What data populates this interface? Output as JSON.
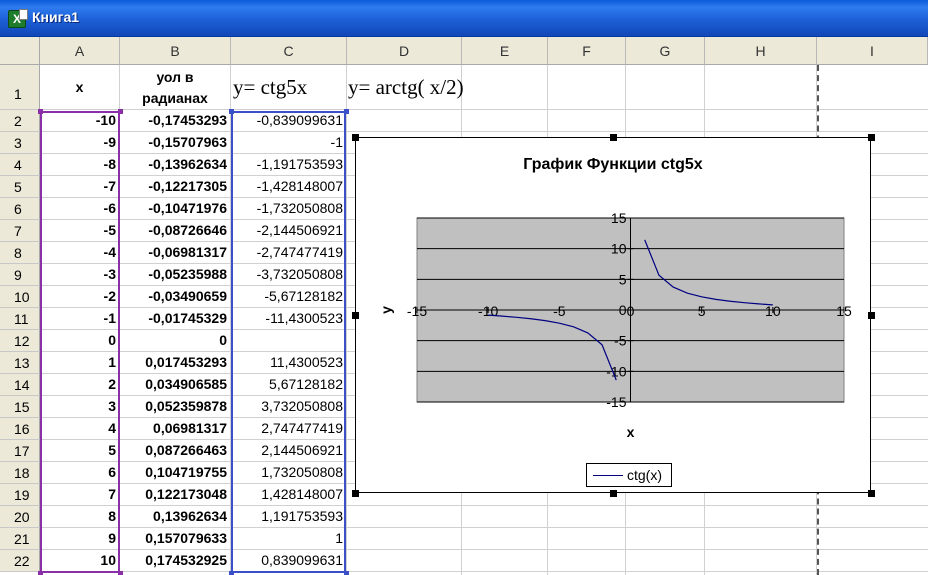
{
  "window": {
    "title": "Книга1"
  },
  "columns": [
    "A",
    "B",
    "C",
    "D",
    "E",
    "F",
    "G",
    "H",
    "I"
  ],
  "rows": [
    "1",
    "2",
    "3",
    "4",
    "5",
    "6",
    "7",
    "8",
    "9",
    "10",
    "11",
    "12",
    "13",
    "14",
    "15",
    "16",
    "17",
    "18",
    "19",
    "20",
    "21",
    "22"
  ],
  "header_row": {
    "a": "x",
    "b_line1": "уол в",
    "b_line2": "радианах",
    "c": "y= ctg5x",
    "d": "y= arctg( x/2)"
  },
  "table": [
    {
      "x": "-10",
      "rad": "-0,17453293",
      "ctg": "-0,839099631"
    },
    {
      "x": "-9",
      "rad": "-0,15707963",
      "ctg": "-1"
    },
    {
      "x": "-8",
      "rad": "-0,13962634",
      "ctg": "-1,191753593"
    },
    {
      "x": "-7",
      "rad": "-0,12217305",
      "ctg": "-1,428148007"
    },
    {
      "x": "-6",
      "rad": "-0,10471976",
      "ctg": "-1,732050808"
    },
    {
      "x": "-5",
      "rad": "-0,08726646",
      "ctg": "-2,144506921"
    },
    {
      "x": "-4",
      "rad": "-0,06981317",
      "ctg": "-2,747477419"
    },
    {
      "x": "-3",
      "rad": "-0,05235988",
      "ctg": "-3,732050808"
    },
    {
      "x": "-2",
      "rad": "-0,03490659",
      "ctg": "-5,67128182"
    },
    {
      "x": "-1",
      "rad": "-0,01745329",
      "ctg": "-11,4300523"
    },
    {
      "x": "0",
      "rad": "0",
      "ctg": ""
    },
    {
      "x": "1",
      "rad": "0,017453293",
      "ctg": "11,4300523"
    },
    {
      "x": "2",
      "rad": "0,034906585",
      "ctg": "5,67128182"
    },
    {
      "x": "3",
      "rad": "0,052359878",
      "ctg": "3,732050808"
    },
    {
      "x": "4",
      "rad": "0,06981317",
      "ctg": "2,747477419"
    },
    {
      "x": "5",
      "rad": "0,087266463",
      "ctg": "2,144506921"
    },
    {
      "x": "6",
      "rad": "0,104719755",
      "ctg": "1,732050808"
    },
    {
      "x": "7",
      "rad": "0,122173048",
      "ctg": "1,428148007"
    },
    {
      "x": "8",
      "rad": "0,13962634",
      "ctg": "1,191753593"
    },
    {
      "x": "9",
      "rad": "0,157079633",
      "ctg": "1"
    },
    {
      "x": "10",
      "rad": "0,174532925",
      "ctg": "0,839099631"
    }
  ],
  "chart_data": {
    "type": "line",
    "title": "График Функции ctg5x",
    "xlabel": "x",
    "ylabel": "y",
    "xlim": [
      -15,
      15
    ],
    "ylim": [
      -15,
      15
    ],
    "x_ticks": [
      "-15",
      "-10",
      "-5",
      "0",
      "5",
      "10",
      "15"
    ],
    "y_ticks": [
      "15",
      "10",
      "5",
      "0",
      "-5",
      "-10",
      "-15"
    ],
    "grid": true,
    "legend_position": "bottom",
    "series": [
      {
        "name": "ctg(x)",
        "color": "#000080",
        "x": [
          -10,
          -9,
          -8,
          -7,
          -6,
          -5,
          -4,
          -3,
          -2,
          -1,
          1,
          2,
          3,
          4,
          5,
          6,
          7,
          8,
          9,
          10
        ],
        "y": [
          -0.839,
          -1,
          -1.192,
          -1.428,
          -1.732,
          -2.145,
          -2.747,
          -3.732,
          -5.671,
          -11.43,
          11.43,
          5.671,
          3.732,
          2.747,
          2.145,
          1.732,
          1.428,
          1.192,
          1,
          0.839
        ]
      }
    ]
  },
  "colors": {
    "plot_area": "#c0c0c0",
    "range_a_border": "#8b2fa8",
    "range_c_border": "#3a4fc8"
  }
}
